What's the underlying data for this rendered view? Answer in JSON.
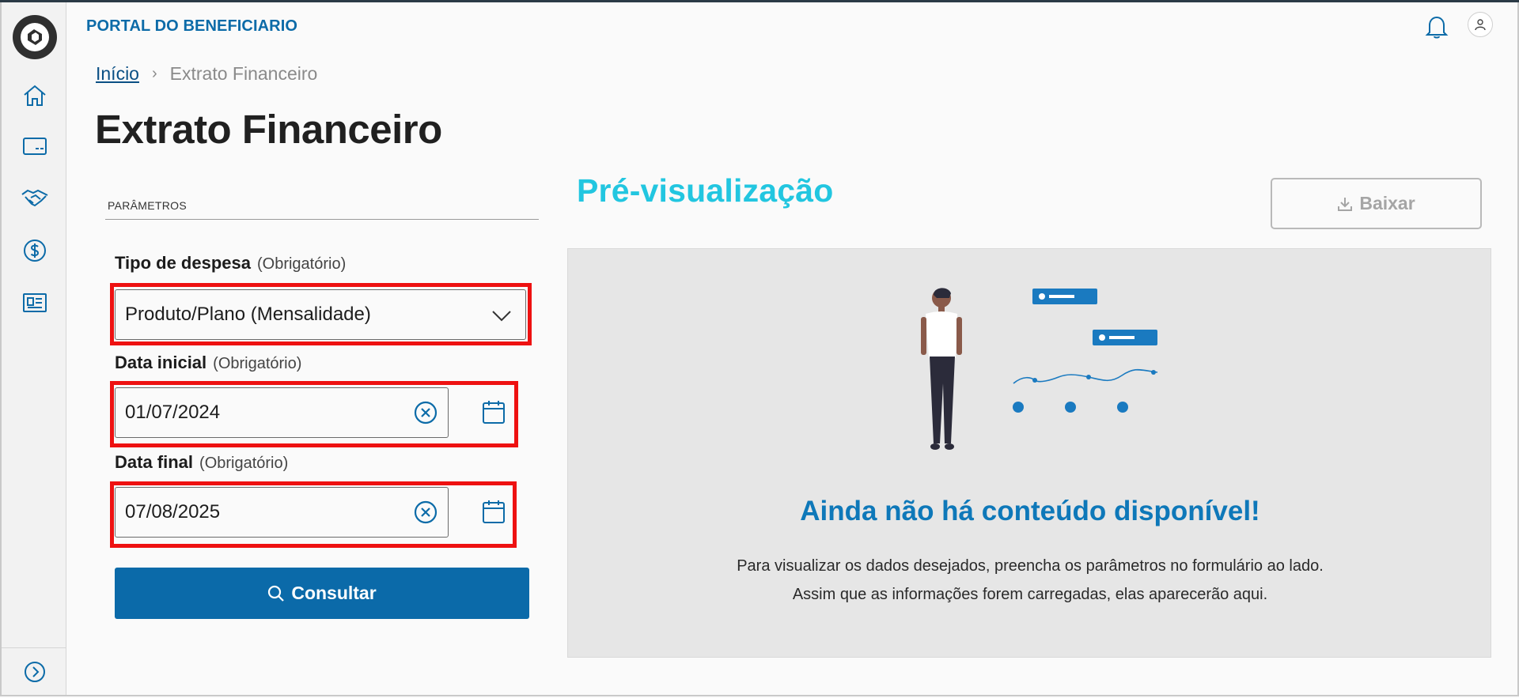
{
  "header": {
    "brand": "PORTAL DO BENEFICIARIO"
  },
  "breadcrumb": {
    "home": "Início",
    "current": "Extrato Financeiro"
  },
  "page": {
    "title": "Extrato Financeiro"
  },
  "form": {
    "section_label": "PARÂMETROS",
    "expense_type": {
      "label": "Tipo de despesa",
      "required": "(Obrigatório)",
      "value": "Produto/Plano (Mensalidade)"
    },
    "start_date": {
      "label": "Data inicial",
      "required": "(Obrigatório)",
      "value": "01/07/2024"
    },
    "end_date": {
      "label": "Data final",
      "required": "(Obrigatório)",
      "value": "07/08/2025"
    },
    "submit_label": "Consultar"
  },
  "preview": {
    "title": "Pré-visualização",
    "download_label": "Baixar",
    "empty_title": "Ainda não há conteúdo disponível!",
    "empty_desc": "Para visualizar os dados desejados, preencha os parâmetros no formulário ao lado. Assim que as informações forem carregadas, elas aparecerão aqui."
  },
  "sidebar": {
    "icons": [
      "home-icon",
      "card-icon",
      "handshake-icon",
      "dollar-icon",
      "receipt-icon"
    ],
    "expand_icon": "chevron-right-circle-icon"
  },
  "colors": {
    "brand": "#0c6ba8",
    "accent": "#22c6e0",
    "primary_button": "#0b6aa9",
    "highlight": "#ee1111"
  }
}
